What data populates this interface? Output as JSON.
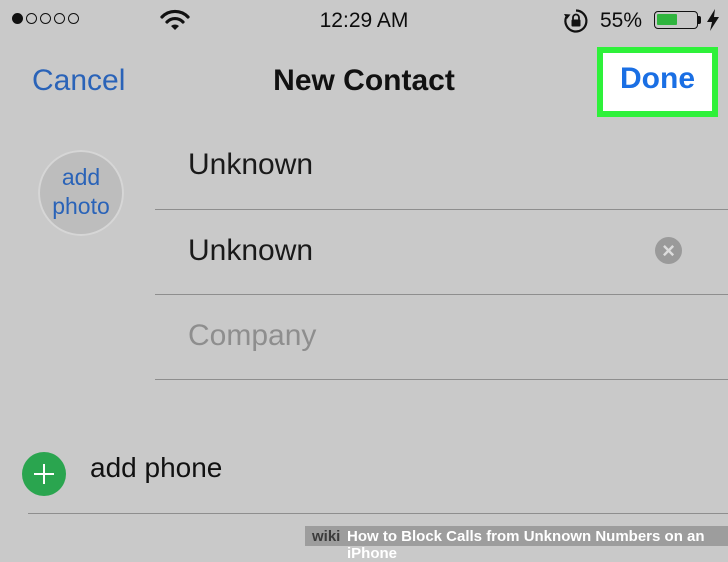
{
  "status_bar": {
    "time": "12:29 AM",
    "battery_percent": "55%",
    "battery_level": 0.55,
    "signal_bars_filled": 1,
    "signal_bars_total": 5,
    "icons": [
      "wifi-icon",
      "orientation-lock-icon",
      "battery-icon",
      "charging-bolt-icon"
    ]
  },
  "nav": {
    "cancel_label": "Cancel",
    "title": "New Contact",
    "done_label": "Done"
  },
  "photo": {
    "label": "add photo"
  },
  "fields": {
    "first_name": "Unknown",
    "last_name": "Unknown",
    "company_placeholder": "Company"
  },
  "add_phone": {
    "label": "add phone"
  },
  "watermark": {
    "brand": "wiki",
    "title": "How to Block Calls from Unknown Numbers on an iPhone"
  },
  "colors": {
    "accent_blue": "#2a63b8",
    "done_blue": "#1a6fe4",
    "highlight_green": "#2ef13a",
    "add_green": "#2aa54f",
    "battery_green": "#2fb53e"
  }
}
